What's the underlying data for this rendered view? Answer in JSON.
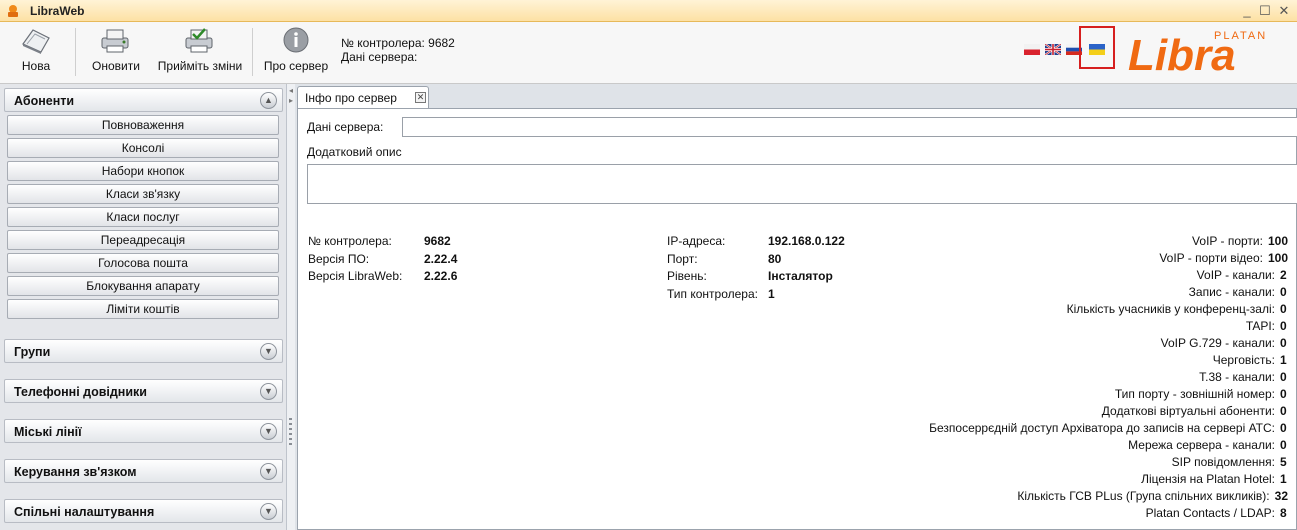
{
  "window": {
    "title": "LibraWeb",
    "controls": [
      "_",
      "☐",
      "✕"
    ]
  },
  "toolbar": {
    "buttons": [
      {
        "label": "Нова",
        "icon": "new-document-icon"
      },
      {
        "label": "Оновити",
        "icon": "refresh-printer-icon"
      },
      {
        "label": "Прийміть зміни",
        "icon": "apply-changes-icon"
      },
      {
        "label": "Про сервер",
        "icon": "info-icon"
      }
    ],
    "controller_label": "№ контролера: 9682",
    "server_data_label": "Дані сервера:",
    "languages": [
      "pl-flag-icon",
      "gb-flag-icon",
      "ru-flag-icon",
      "ua-flag-icon"
    ],
    "logo_text": "Libra",
    "logo_subtext": "PLATAN"
  },
  "sidebar": {
    "sections": [
      {
        "title": "Абоненти",
        "expanded": true
      },
      {
        "title": "Групи",
        "expanded": false
      },
      {
        "title": "Телефонні довідники",
        "expanded": false
      },
      {
        "title": "Міські лінії",
        "expanded": false
      },
      {
        "title": "Керування зв'язком",
        "expanded": false
      },
      {
        "title": "Спільні налаштування",
        "expanded": false
      }
    ],
    "items": [
      "Повноваження",
      "Консолі",
      "Набори кнопок",
      "Класи зв'язку",
      "Класи послуг",
      "Переадресація",
      "Голосова пошта",
      "Блокування апарату",
      "Ліміти коштів"
    ]
  },
  "tab": {
    "label": "Інфо про сервер",
    "close": "✕"
  },
  "form": {
    "server_data_label": "Дані сервера:",
    "server_data_value": "",
    "extra_desc_label": "Додатковий опис",
    "extra_desc_value": ""
  },
  "info_left": [
    {
      "k": "№ контролера:",
      "v": "9682"
    },
    {
      "k": "Версія ПО:",
      "v": "2.22.4"
    },
    {
      "k": "Версія LibraWeb:",
      "v": "2.22.6"
    }
  ],
  "info_mid": [
    {
      "k": "IP-адреса:",
      "v": "192.168.0.122"
    },
    {
      "k": "Порт:",
      "v": "80"
    },
    {
      "k": "Рівень:",
      "v": "Інсталятор"
    },
    {
      "k": "Тип контролера:",
      "v": "1"
    }
  ],
  "info_right": [
    {
      "k": "VoIP - порти:",
      "v": "100"
    },
    {
      "k": "VoIP - порти відео:",
      "v": "100"
    },
    {
      "k": "VoIP - канали:",
      "v": "2"
    },
    {
      "k": "Запис - канали:",
      "v": "0"
    },
    {
      "k": "Кількість учасників у конференц-залі:",
      "v": "0"
    },
    {
      "k": "TAPI:",
      "v": "0"
    },
    {
      "k": "VoIP G.729 - канали:",
      "v": "0"
    },
    {
      "k": "Черговість:",
      "v": "1"
    },
    {
      "k": "T.38 - канали:",
      "v": "0"
    },
    {
      "k": "Тип порту - зовнішній номер:",
      "v": "0"
    },
    {
      "k": "Додаткові віртуальні абоненти:",
      "v": "0"
    },
    {
      "k": "Безпосеррєдній  доступ Архіватора до записів на сервері АТС:",
      "v": "0"
    },
    {
      "k": "Мережа сервера - канали:",
      "v": "0"
    },
    {
      "k": "SIP повідомлення:",
      "v": "5"
    },
    {
      "k": "Ліцензія на Platan Hotel:",
      "v": "1"
    },
    {
      "k": "Кількість ГСВ PLus (Група спільних викликів):",
      "v": "32"
    },
    {
      "k": "Platan Contacts / LDAP:",
      "v": "8"
    }
  ],
  "colors": {
    "accent": "#f06a12",
    "titlebar": "#fde1a4",
    "highlight": "#d61f1f"
  }
}
